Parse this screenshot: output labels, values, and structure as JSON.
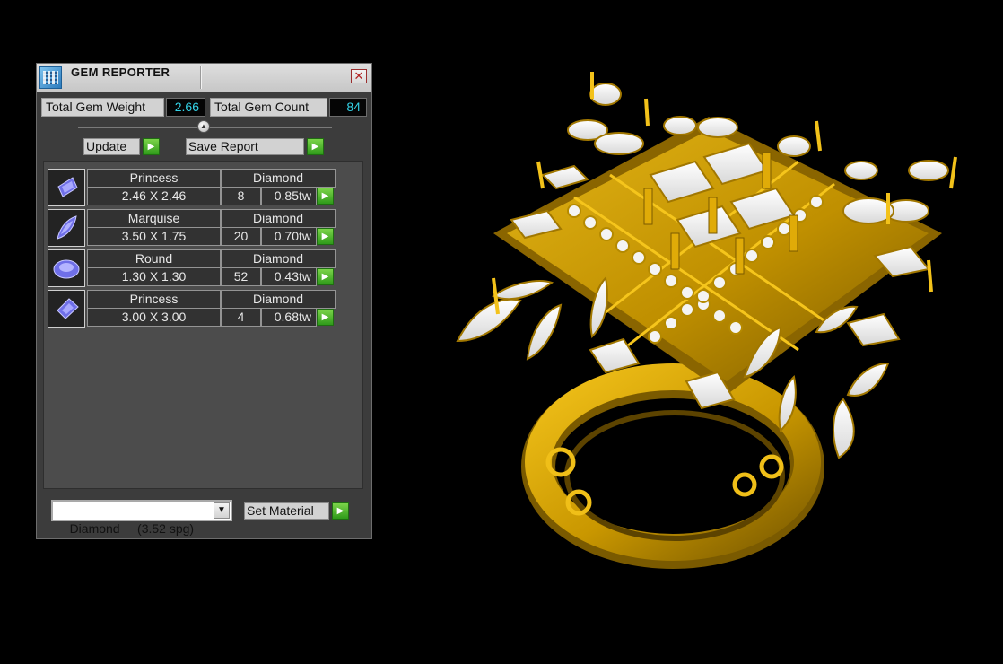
{
  "panel": {
    "title": "GEM REPORTER",
    "close_glyph": "✕",
    "total_weight_label": "Total Gem Weight",
    "total_weight_value": "2.66",
    "total_count_label": "Total Gem Count",
    "total_count_value": "84",
    "update_label": "Update",
    "save_report_label": "Save Report",
    "go_glyph": "▶",
    "slider_glyph": "▲"
  },
  "gems": [
    {
      "shape": "Princess",
      "size": "2.46 X 2.46",
      "material": "Diamond",
      "count": "8",
      "weight": "0.85tw",
      "icon": "princess-gem-icon"
    },
    {
      "shape": "Marquise",
      "size": "3.50 X 1.75",
      "material": "Diamond",
      "count": "20",
      "weight": "0.70tw",
      "icon": "marquise-gem-icon"
    },
    {
      "shape": "Round",
      "size": "1.30 X 1.30",
      "material": "Diamond",
      "count": "52",
      "weight": "0.43tw",
      "icon": "round-gem-icon"
    },
    {
      "shape": "Princess",
      "size": "3.00 X 3.00",
      "material": "Diamond",
      "count": "4",
      "weight": "0.68tw",
      "icon": "princess-gem-icon"
    }
  ],
  "material": {
    "selected": "Diamond     (3.52 spg)",
    "dropdown_glyph": "▼",
    "set_label": "Set Material"
  },
  "colors": {
    "background": "#000000",
    "panel": "#3c3c3c",
    "value_text": "#34d2e6",
    "gold": "#d4a300",
    "go_button": "#3fae22"
  }
}
